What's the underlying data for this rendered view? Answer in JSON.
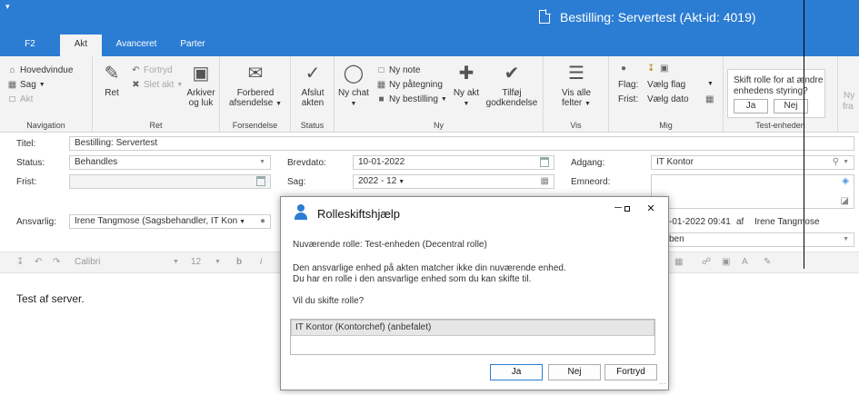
{
  "window": {
    "title": "Bestilling: Servertest (Akt-id: 4019)",
    "accent": "#2b7cd3"
  },
  "tabs": [
    "F2",
    "Akt",
    "Avanceret",
    "Parter"
  ],
  "ribbon": {
    "navigation": {
      "label": "Navigation",
      "items": [
        "Hovedvindue",
        "Sag",
        "Akt"
      ]
    },
    "ret": {
      "label": "Ret",
      "big": "Ret",
      "small": [
        "Fortryd",
        "Slet akt"
      ],
      "arkiver": "Arkiver og luk"
    },
    "forsendelse": {
      "label": "Forsendelse",
      "big": "Forbered afsendelse"
    },
    "status": {
      "label": "Status",
      "big": "Afslut akten"
    },
    "ny": {
      "label": "Ny",
      "chat": "Ny chat",
      "small": [
        "Ny note",
        "Ny påtegning",
        "Ny bestilling"
      ],
      "akt": "Ny akt",
      "godkendelse": "Tilføj godkendelse"
    },
    "vis": {
      "label": "Vis",
      "big": "Vis alle felter"
    },
    "mig": {
      "label": "Mig",
      "flag_label": "Flag:",
      "flag_value": "Vælg flag",
      "frist_label": "Frist:",
      "frist_value": "Vælg dato"
    },
    "test_enheden": {
      "label": "Test-enheden",
      "question": "Skift rolle for at ændre enhedens styring?",
      "yes": "Ja",
      "no": "Nej"
    },
    "overflow": {
      "top": "Ny",
      "bottom": "fra"
    }
  },
  "form": {
    "titel_label": "Titel:",
    "titel_value": "Bestilling: Servertest",
    "status_label": "Status:",
    "status_value": "Behandles",
    "brevdato_label": "Brevdato:",
    "brevdato_value": "10-01-2022",
    "adgang_label": "Adgang:",
    "adgang_value": "IT Kontor",
    "frist_label": "Frist:",
    "sag_label": "Sag:",
    "sag_value": "2022 - 12",
    "emneord_label": "Emneord:",
    "ansvarlig_label": "Ansvarlig:",
    "ansvarlig_value": "Irene Tangmose (Sagsbehandler, IT Kon",
    "modified_date": "-01-2022 09:41",
    "modified_by_label": "af",
    "modified_by": "Irene Tangmose",
    "hidden_field_partial": "ben"
  },
  "editor": {
    "font": "Calibri",
    "size": "12",
    "body": "Test af server."
  },
  "dialog": {
    "title": "Rolleskiftshjælp",
    "current_role": "Nuværende rolle: Test-enheden (Decentral rolle)",
    "line1": "Den ansvarlige enhed på akten matcher ikke din nuværende enhed.",
    "line2": "Du har en rolle i den ansvarlige enhed som du kan skifte til.",
    "question": "Vil du skifte rolle?",
    "option": "IT Kontor (Kontorchef) (anbefalet)",
    "yes": "Ja",
    "no": "Nej",
    "cancel": "Fortryd"
  }
}
